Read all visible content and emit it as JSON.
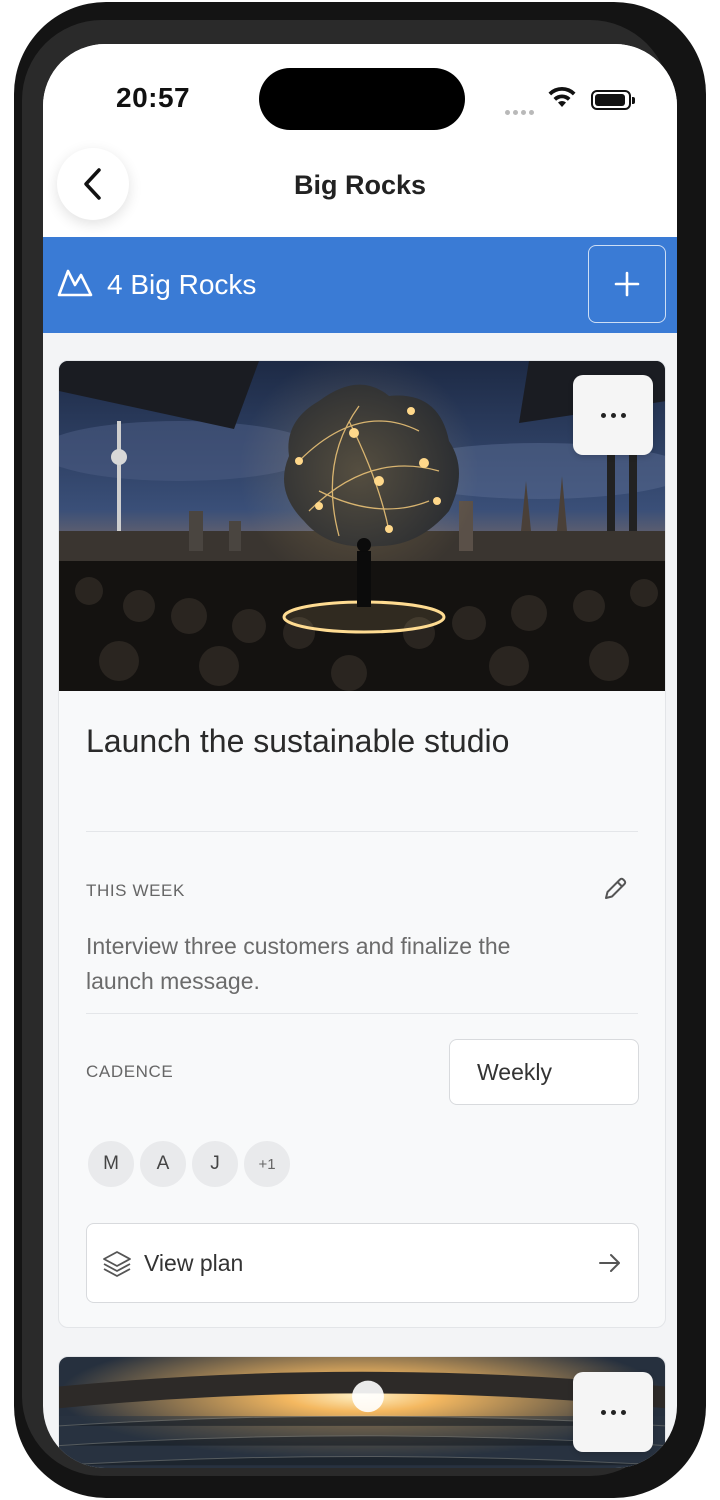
{
  "status_bar": {
    "time": "20:57"
  },
  "header": {
    "title": "Big Rocks",
    "back_icon": "chevron-left-icon"
  },
  "rocks_bar": {
    "count_label": "4 Big Rocks",
    "icon": "mountain-icon",
    "add_icon": "plus-icon",
    "color": "#3a7bd5"
  },
  "cards": [
    {
      "image_description_icon": "event-image",
      "title": "Launch the sustainable studio",
      "this_week_label": "THIS WEEK",
      "this_week_text": "Interview three customers and finalize the launch message.",
      "cadence_label": "CADENCE",
      "cadence_value": "Weekly",
      "avatars": [
        "M",
        "A",
        "J",
        "+1"
      ],
      "view_plan_label": "View plan"
    }
  ]
}
